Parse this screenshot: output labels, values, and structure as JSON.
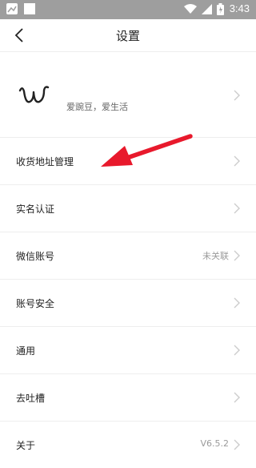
{
  "status_bar": {
    "time": "3:43",
    "icons": [
      "notification-icon",
      "gallery-icon",
      "wifi-icon",
      "battery-icon"
    ]
  },
  "header": {
    "title": "设置",
    "back_icon": "back-chevron-icon"
  },
  "profile": {
    "logo_text": "w",
    "slogan": "爱豌豆，爱生活"
  },
  "settings": {
    "items": [
      {
        "label": "收货地址管理",
        "value": ""
      },
      {
        "label": "实名认证",
        "value": ""
      },
      {
        "label": "微信账号",
        "value": "未关联"
      },
      {
        "label": "账号安全",
        "value": ""
      },
      {
        "label": "通用",
        "value": ""
      },
      {
        "label": "去吐槽",
        "value": ""
      },
      {
        "label": "关于",
        "value": "V6.5.2"
      }
    ]
  },
  "annotation": {
    "arrow_color": "#e8192c",
    "points_to": "收货地址管理"
  },
  "colors": {
    "status_bar": "#9e9e9e",
    "divider": "#eeeeee",
    "chevron": "#cccccc"
  }
}
